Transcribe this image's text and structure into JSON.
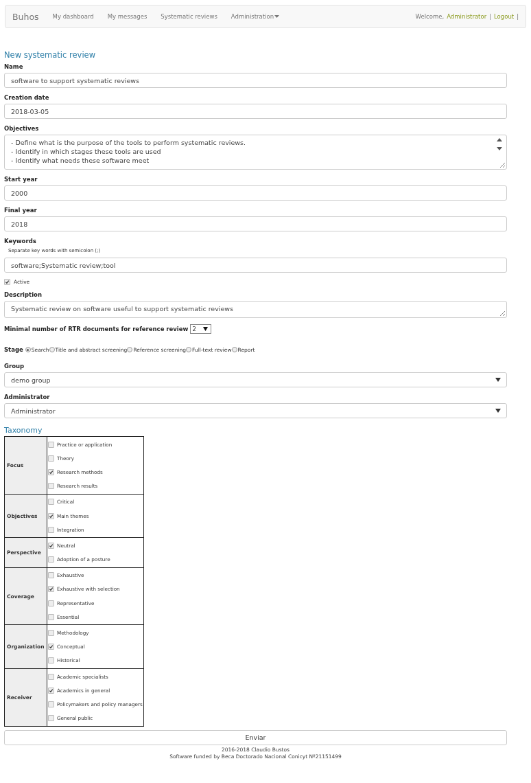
{
  "navbar": {
    "brand": "Buhos",
    "links": [
      {
        "label": "My dashboard",
        "dropdown": false
      },
      {
        "label": "My messages",
        "dropdown": false
      },
      {
        "label": "Systematic reviews",
        "dropdown": false
      },
      {
        "label": "Administration",
        "dropdown": true
      }
    ],
    "user_area": [
      {
        "kind": "text",
        "text": "Welcome,"
      },
      {
        "kind": "link",
        "text": "Administrator"
      },
      {
        "kind": "text",
        "text": "|"
      },
      {
        "kind": "link",
        "text": "Logout"
      },
      {
        "kind": "text",
        "text": "|"
      }
    ]
  },
  "page_title": "New systematic review",
  "fields": [
    {
      "kind": "input",
      "label": "Name",
      "value": "software to support systematic reviews"
    },
    {
      "kind": "input",
      "label": "Creation date",
      "value": "2018-03-05"
    },
    {
      "kind": "textarea",
      "label": "Objectives",
      "value": "- Define what is the purpose of the tools to perform systematic reviews.\n- Identify in which stages these tools are used\n- Identify what needs these software meet"
    },
    {
      "kind": "input",
      "label": "Start year",
      "value": "2000"
    },
    {
      "kind": "input",
      "label": "Final year",
      "value": "2018"
    },
    {
      "kind": "input",
      "label": "Keywords",
      "help": "Separate key words with semicolon (;)",
      "value": "software;Systematic review;tool"
    },
    {
      "kind": "checkbox",
      "label": "Active",
      "checked": true
    },
    {
      "kind": "textarea",
      "label": "Description",
      "value": "Systematic review on software useful to support systematic reviews"
    },
    {
      "kind": "inline-select",
      "label": "Minimal number of RTR documents for reference review",
      "value": "2"
    },
    {
      "kind": "radio",
      "label": "Stage",
      "options": [
        {
          "label": "Search",
          "selected": true
        },
        {
          "label": "Title and abstract screening",
          "selected": false
        },
        {
          "label": "Reference screening",
          "selected": false
        },
        {
          "label": "Full-text review",
          "selected": false
        },
        {
          "label": "Report",
          "selected": false
        }
      ]
    },
    {
      "kind": "select",
      "label": "Group",
      "value": "demo group"
    },
    {
      "kind": "select",
      "label": "Administrator",
      "value": "Administrator"
    }
  ],
  "taxonomy": {
    "title": "Taxonomy",
    "groups": [
      {
        "name": "Focus",
        "options": [
          {
            "label": "Practice or application",
            "checked": false
          },
          {
            "label": "Theory",
            "checked": false
          },
          {
            "label": "Research methods",
            "checked": true
          },
          {
            "label": "Research results",
            "checked": false
          }
        ]
      },
      {
        "name": "Objectives",
        "options": [
          {
            "label": "Critical",
            "checked": false
          },
          {
            "label": "Main themes",
            "checked": true
          },
          {
            "label": "Integration",
            "checked": false
          }
        ]
      },
      {
        "name": "Perspective",
        "options": [
          {
            "label": "Neutral",
            "checked": true
          },
          {
            "label": "Adoption of a posture",
            "checked": false
          }
        ]
      },
      {
        "name": "Coverage",
        "options": [
          {
            "label": "Exhaustive",
            "checked": false
          },
          {
            "label": "Exhaustive with selection",
            "checked": true
          },
          {
            "label": "Representative",
            "checked": false
          },
          {
            "label": "Essential",
            "checked": false
          }
        ]
      },
      {
        "name": "Organization",
        "options": [
          {
            "label": "Methodology",
            "checked": false
          },
          {
            "label": "Conceptual",
            "checked": true
          },
          {
            "label": "Historical",
            "checked": false
          }
        ]
      },
      {
        "name": "Receiver",
        "options": [
          {
            "label": "Academic specialists",
            "checked": false
          },
          {
            "label": "Academics in general",
            "checked": true
          },
          {
            "label": "Policymakers and policy managers",
            "checked": false
          },
          {
            "label": "General public",
            "checked": false
          }
        ]
      }
    ]
  },
  "submit": "Enviar",
  "footer": [
    "2016-2018 Claudio Bustos",
    "Software funded by Beca Doctorado Nacional Conicyt Nº21151499"
  ]
}
